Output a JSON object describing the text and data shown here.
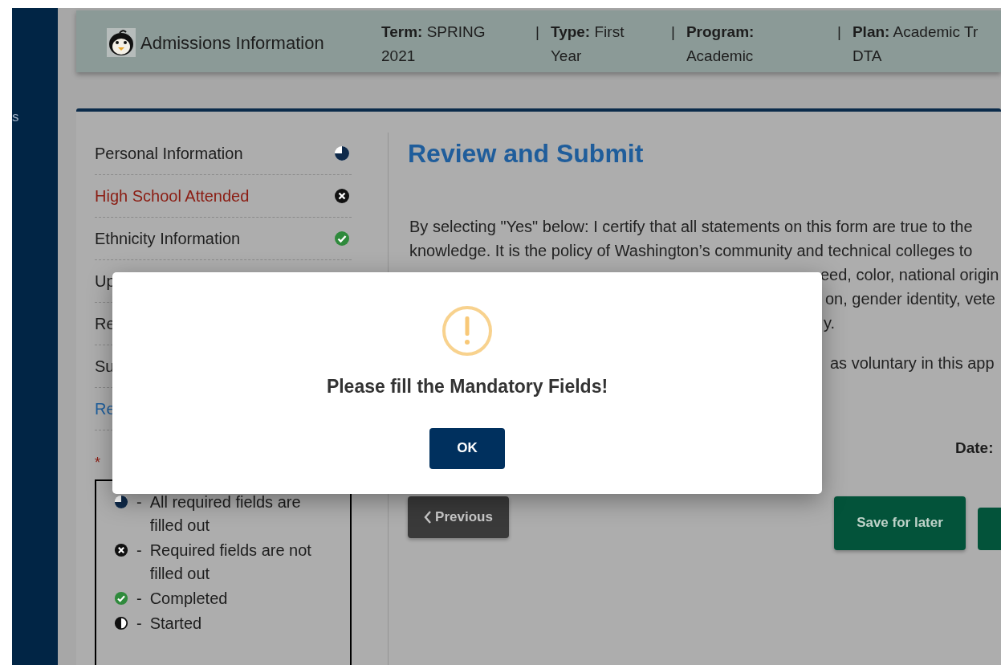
{
  "side_rail": {
    "label": "s"
  },
  "header": {
    "title": "Admissions Information",
    "fields": [
      {
        "label": "Term:",
        "value": "SPRING",
        "continued": "2021"
      },
      {
        "separator": "|",
        "label": "Type:",
        "value": "First",
        "continued": "Year"
      },
      {
        "separator": "|",
        "label": "Program:",
        "continued": "Academic"
      },
      {
        "separator": "|",
        "label": "Plan:",
        "value": "Academic Tr",
        "continued": "DTA"
      }
    ]
  },
  "steps": [
    {
      "label": "Personal Information",
      "kind": "partial",
      "selected": false
    },
    {
      "label": "High School Attended",
      "kind": "error",
      "selected": false
    },
    {
      "label": "Ethnicity Information",
      "kind": "complete",
      "selected": false
    },
    {
      "label": "Up",
      "selected": false
    },
    {
      "label": "Re",
      "selected": false
    },
    {
      "label": "Su",
      "selected": false
    },
    {
      "label": "Re",
      "selected": true
    }
  ],
  "required_mark": "*",
  "legend": [
    {
      "kind": "partial",
      "dash": "-",
      "text": "All required fields are filled out"
    },
    {
      "kind": "error",
      "dash": "-",
      "text": "Required fields are not filled out"
    },
    {
      "kind": "complete",
      "dash": "-",
      "text": "Completed"
    },
    {
      "kind": "started",
      "dash": "-",
      "text": "Started"
    }
  ],
  "page_title": "Review and Submit",
  "statement_lines": [
    {
      "kind": "full",
      "text": "By selecting \"Yes\" below: I certify that all statements on this form are true to the"
    },
    {
      "kind": "full",
      "text": "knowledge. It is the policy of Washington’s community and technical colleges to"
    },
    {
      "kind": "tail",
      "text": "eed, color, national origin"
    },
    {
      "kind": "tail",
      "text": "on, gender identity, vete"
    },
    {
      "kind": "tail",
      "text": "y."
    },
    {
      "kind": "gap_tail",
      "text": "as voluntary in this app"
    }
  ],
  "date_label": "Date:",
  "buttons": {
    "previous": "Previous",
    "save": "Save for later"
  },
  "dialog": {
    "message": "Please fill the Mandatory Fields!",
    "ok": "OK"
  }
}
